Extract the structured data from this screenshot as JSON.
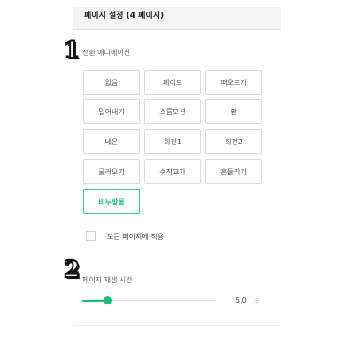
{
  "header": {
    "title": "페이지 설정 (4 페이지)"
  },
  "transition": {
    "badge": "1",
    "label": "전환 애니메이션",
    "buttons": [
      {
        "label": "없음"
      },
      {
        "label": "페이드"
      },
      {
        "label": "떠오르기"
      },
      {
        "label": "밀어내기"
      },
      {
        "label": "스름모션"
      },
      {
        "label": "팝"
      },
      {
        "label": "네온"
      },
      {
        "label": "회전1"
      },
      {
        "label": "회전2"
      },
      {
        "label": "굴러오기"
      },
      {
        "label": "수직교차"
      },
      {
        "label": "흔들리기"
      },
      {
        "label": "비누방울",
        "selected": true
      }
    ],
    "apply_all_label": "모든 페이지에 적용",
    "apply_all_checked": false
  },
  "duration": {
    "badge": "2",
    "label": "페이지 재생 시간",
    "value": "5.0",
    "unit": "s",
    "slider_fraction": 0.19
  },
  "colors": {
    "accent": "#1fbf78",
    "header_bg": "#f4f4f4"
  }
}
